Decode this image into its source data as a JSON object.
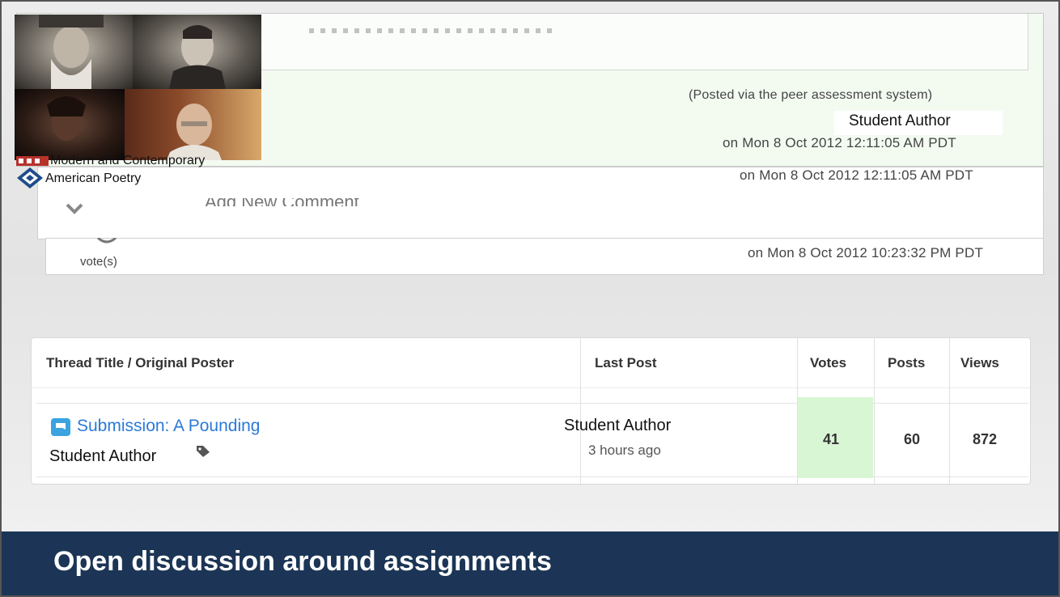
{
  "course": {
    "title_line1": "Modern and Contemporary",
    "title_line2": "American Poetry"
  },
  "comments": [
    {
      "via_note": "(Posted via the peer assessment system)",
      "author": "Student Author",
      "timestamp": "on Mon 8 Oct 2012 12:11:05 AM PDT"
    },
    {
      "timestamp": "on Mon 8 Oct 2012 12:11:05 AM PDT",
      "add_comment_label": "Add New Comment"
    },
    {
      "votes_label": "vote(s)",
      "timestamp": "on Mon 8 Oct 2012 10:23:32 PM PDT"
    }
  ],
  "thread_table": {
    "headers": {
      "title": "Thread Title / Original Poster",
      "last_post": "Last Post",
      "votes": "Votes",
      "posts": "Posts",
      "views": "Views"
    },
    "rows": [
      {
        "title": "Submission: A Pounding",
        "poster": "Student Author",
        "last_post_author": "Student Author",
        "last_post_time": "3 hours ago",
        "votes": "41",
        "posts": "60",
        "views": "872"
      }
    ]
  },
  "footer": {
    "title": "Open discussion around assignments"
  },
  "colors": {
    "footer_bg": "#1c3556",
    "link_blue": "#2a7ad8",
    "votes_highlight": "#d9f6d4",
    "comment_bg": "#f3fbf1"
  }
}
